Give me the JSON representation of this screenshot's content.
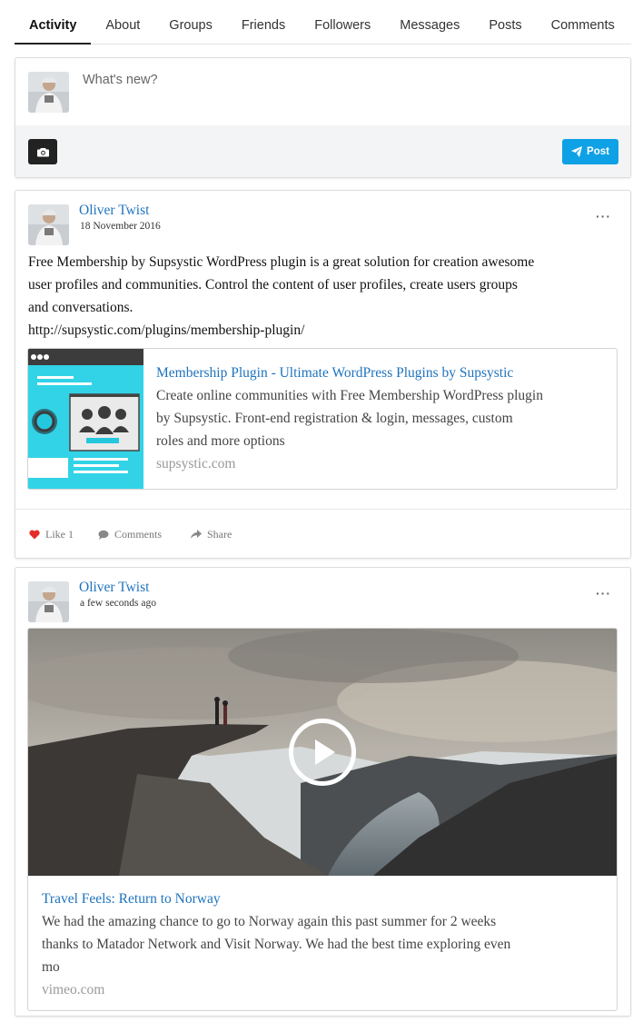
{
  "tabs": [
    {
      "label": "Activity"
    },
    {
      "label": "About"
    },
    {
      "label": "Groups"
    },
    {
      "label": "Friends"
    },
    {
      "label": "Followers"
    },
    {
      "label": "Messages"
    },
    {
      "label": "Posts"
    },
    {
      "label": "Comments"
    }
  ],
  "composer": {
    "placeholder": "What's new?",
    "post_label": "Post",
    "camera_icon": "camera-icon",
    "post_icon": "paper-plane-icon",
    "accent": "#0fa1e6"
  },
  "posts": [
    {
      "author": "Oliver Twist",
      "date": "18 November 2016",
      "more": "···",
      "text_lines": [
        "Free Membership by Supsystic WordPress plugin is a great solution for creation awesome",
        "user profiles and communities. Control the content of user profiles, create users groups",
        "and conversations.",
        "http://supsystic.com/plugins/membership-plugin/"
      ],
      "link": {
        "title": "Membership Plugin - Ultimate WordPress Plugins by Supsystic",
        "desc_lines": [
          "Create online communities with Free Membership WordPress plugin",
          "by Supsystic. Front-end registration & login, messages, custom",
          "roles and more options"
        ],
        "domain": "supsystic.com"
      },
      "actions": {
        "like": "Like 1",
        "comments": "Comments",
        "share": "Share"
      }
    },
    {
      "author": "Oliver Twist",
      "date": "a few seconds ago",
      "more": "···",
      "video": {
        "title": "Travel Feels: Return to Norway",
        "desc_lines": [
          "We had the amazing chance to go to Norway again this past summer for 2 weeks",
          "thanks to Matador Network and Visit Norway. We had the best time exploring even",
          "mo"
        ],
        "domain": "vimeo.com"
      }
    }
  ]
}
